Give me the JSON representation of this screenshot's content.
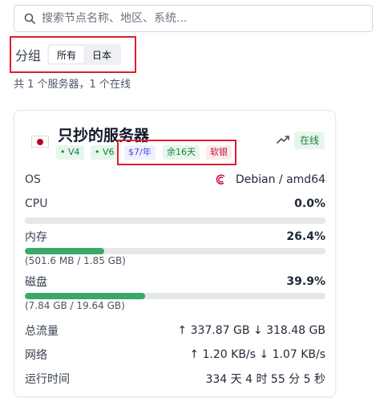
{
  "search": {
    "placeholder": "搜索节点名称、地区、系统..."
  },
  "group": {
    "label": "分组",
    "options": [
      "所有",
      "日本"
    ],
    "selected": "所有"
  },
  "summary": "共 1 个服务器，1 个在线",
  "server": {
    "name": "只抄的服务器",
    "flag": "Japan",
    "status": "在线",
    "tags": {
      "v4": "• V4",
      "v6": "• V6",
      "price": "$7/年",
      "remaining": "余16天",
      "soft": "软银"
    },
    "os": {
      "label": "OS",
      "value": "Debian / amd64"
    },
    "cpu": {
      "label": "CPU",
      "value": "0.0%",
      "fraction": 0.0
    },
    "memory": {
      "label": "内存",
      "value": "26.4%",
      "fraction": 0.264,
      "detail": "(501.6 MB / 1.85 GB)"
    },
    "disk": {
      "label": "磁盘",
      "value": "39.9%",
      "fraction": 0.399,
      "detail": "(7.84 GB / 19.64 GB)"
    },
    "traffic": {
      "label": "总流量",
      "value": "↑ 337.87 GB ↓ 318.48 GB"
    },
    "network": {
      "label": "网络",
      "value": "↑ 1.20 KB/s ↓ 1.07 KB/s"
    },
    "uptime": {
      "label": "运行时间",
      "value": "334 天 4 时 55 分 5 秒"
    }
  },
  "colors": {
    "accent_green": "#3aa86b",
    "highlight_red": "#e11d2e",
    "online_bg": "#e7f6ec"
  }
}
